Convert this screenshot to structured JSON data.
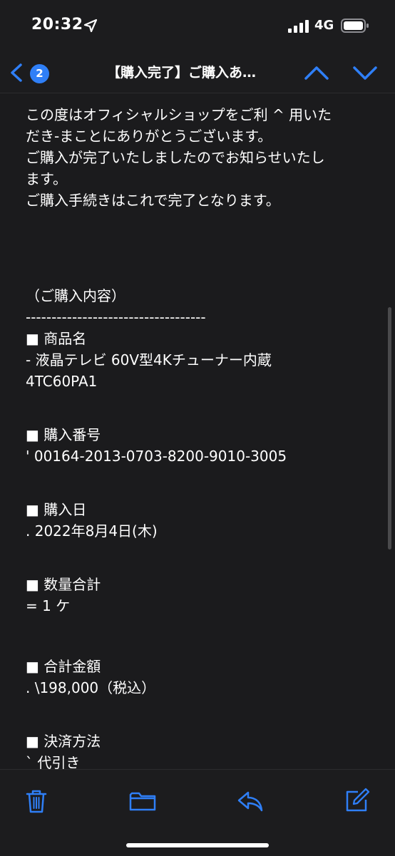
{
  "status_bar": {
    "time": "20:32",
    "network": "4G",
    "icons": [
      "location-arrow-icon",
      "cellular-signal-icon",
      "battery-icon"
    ]
  },
  "nav": {
    "unread_count": "2",
    "title": "【購入完了】ご購入あ…",
    "icons": [
      "chevron-left-icon",
      "chevron-up-icon",
      "chevron-down-icon"
    ]
  },
  "email_body": {
    "lines": [
      "この度はオフィシャルショップをご利 ^ 用いた",
      "だき-まことにありがとうございます。",
      "ご購入が完了いたしましたのでお知らせいたし",
      "ます。",
      "ご購入手続きはこれで完了となります。",
      "",
      "",
      "（ご購入内容）",
      "-----------------------------------",
      "■ 商品名",
      "- 液晶テレビ 60V型4Kチューナー内蔵",
      "4TC60PA1",
      "",
      "■ 購入番号",
      "' 00164-2013-0703-8200-9010-3005",
      "",
      "■ 購入日",
      ". 2022年8月4日(木)",
      "",
      "■ 数量合計",
      "= 1 ケ",
      "",
      "■ 合計金額",
      ". \\198,000（税込）",
      "",
      "■ 決済方法",
      "` 代引き",
      "-----------------------------------"
    ]
  },
  "toolbar": {
    "icons": [
      "trash-icon",
      "folder-icon",
      "reply-icon",
      "compose-icon"
    ]
  },
  "colors": {
    "accent": "#2f7ff7",
    "background": "#1b1b1d",
    "bar_background": "#1c1c1e",
    "text": "#ffffff"
  }
}
